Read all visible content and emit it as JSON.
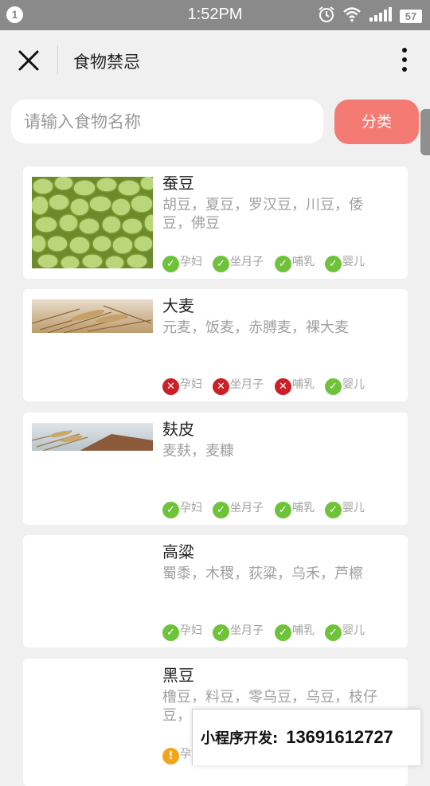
{
  "status_bar": {
    "notification_count": "1",
    "time": "1:52PM",
    "battery": "57",
    "icons": [
      "alarm-icon",
      "wifi-icon",
      "signal-icon"
    ]
  },
  "header": {
    "title": "食物禁忌",
    "close_icon": "close-icon",
    "more_icon": "more-vertical-icon"
  },
  "search": {
    "placeholder": "请输入食物名称",
    "value": "",
    "category_label": "分类"
  },
  "colors": {
    "accent": "#f37b73",
    "ok": "#6fc33b",
    "no": "#cc1f26",
    "caution": "#f2a51c"
  },
  "foods": [
    {
      "name": "蚕豆",
      "aliases": "胡豆，夏豆，罗汉豆，川豆，倭豆，佛豆",
      "status": [
        {
          "label": "孕妇",
          "state": "ok"
        },
        {
          "label": "坐月子",
          "state": "ok"
        },
        {
          "label": "哺乳",
          "state": "ok"
        },
        {
          "label": "婴儿",
          "state": "ok"
        }
      ]
    },
    {
      "name": "大麦",
      "aliases": "元麦，饭麦，赤膊麦，裸大麦",
      "status": [
        {
          "label": "孕妇",
          "state": "no"
        },
        {
          "label": "坐月子",
          "state": "no"
        },
        {
          "label": "哺乳",
          "state": "no"
        },
        {
          "label": "婴儿",
          "state": "ok"
        }
      ]
    },
    {
      "name": "麸皮",
      "aliases": "麦麸，麦糠",
      "status": [
        {
          "label": "孕妇",
          "state": "ok"
        },
        {
          "label": "坐月子",
          "state": "ok"
        },
        {
          "label": "哺乳",
          "state": "ok"
        },
        {
          "label": "婴儿",
          "state": "ok"
        }
      ]
    },
    {
      "name": "高粱",
      "aliases": "蜀黍，木稷，荻粱，乌禾，芦檫",
      "status": [
        {
          "label": "孕妇",
          "state": "ok"
        },
        {
          "label": "坐月子",
          "state": "ok"
        },
        {
          "label": "哺乳",
          "state": "ok"
        },
        {
          "label": "婴儿",
          "state": "ok"
        }
      ]
    },
    {
      "name": "黑豆",
      "aliases": "橹豆，料豆，零乌豆，乌豆，枝仔豆，",
      "status": [
        {
          "label": "孕妇",
          "state": "caution"
        }
      ]
    }
  ],
  "promo": {
    "label": "小程序开发:",
    "phone": "13691612727"
  }
}
